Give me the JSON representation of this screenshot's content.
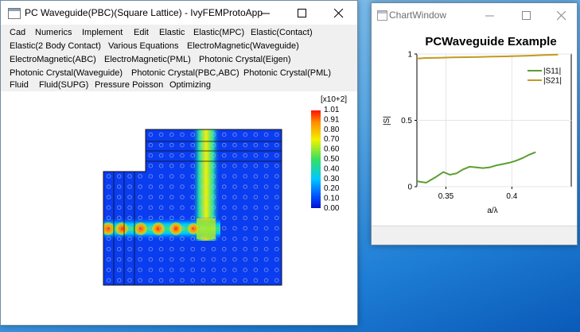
{
  "main_window": {
    "title": "PC Waveguide(PBC)(Square Lattice) - IvyFEMProtoApp",
    "menu_rows": [
      [
        "Cad",
        "Numerics",
        "Implement",
        "Edit",
        "Elastic",
        "Elastic(MPC)",
        "Elastic(Contact)"
      ],
      [
        "Elastic(2 Body Contact)",
        "Various Equations",
        "ElectroMagnetic(Waveguide)"
      ],
      [
        "ElectroMagnetic(ABC)",
        "ElectroMagnetic(PML)",
        "Photonic Crystal(Eigen)"
      ],
      [
        "Photonic Crystal(Waveguide)",
        "Photonic Crystal(PBC,ABC)",
        "Photonic Crystal(PML)"
      ],
      [
        "Fluid",
        "Fluid(SUPG)",
        "Pressure Poisson",
        "Optimizing"
      ]
    ],
    "colorbar": {
      "scale_label": "[x10+2]",
      "ticks": [
        "1.01",
        "0.91",
        "0.80",
        "0.70",
        "0.60",
        "0.50",
        "0.40",
        "0.30",
        "0.20",
        "0.10",
        "0.00"
      ]
    }
  },
  "chart_window": {
    "title": "ChartWindow"
  },
  "chart_data": {
    "type": "line",
    "title": "PCWaveguide Example",
    "xlabel": "a/λ",
    "ylabel": "|S|",
    "xlim": [
      0.328,
      0.445
    ],
    "ylim": [
      0,
      1
    ],
    "x_ticks": [
      "0.35",
      "0.4"
    ],
    "y_ticks": [
      "0",
      "0.5",
      "1"
    ],
    "legend_position": "top-right",
    "series": [
      {
        "name": "|S11|",
        "color": "#5a9e2e",
        "x": [
          0.328,
          0.335,
          0.342,
          0.348,
          0.353,
          0.358,
          0.363,
          0.368,
          0.373,
          0.378,
          0.383,
          0.388,
          0.393,
          0.398,
          0.403,
          0.408,
          0.413,
          0.418
        ],
        "y": [
          0.04,
          0.03,
          0.07,
          0.11,
          0.09,
          0.1,
          0.13,
          0.15,
          0.145,
          0.14,
          0.145,
          0.16,
          0.17,
          0.18,
          0.195,
          0.215,
          0.24,
          0.26
        ]
      },
      {
        "name": "|S21|",
        "color": "#c49a1e",
        "x": [
          0.328,
          0.335,
          0.345,
          0.355,
          0.365,
          0.375,
          0.385,
          0.395,
          0.405,
          0.415,
          0.425,
          0.435
        ],
        "y": [
          0.965,
          0.97,
          0.972,
          0.974,
          0.976,
          0.978,
          0.98,
          0.982,
          0.985,
          0.988,
          0.992,
          0.995
        ]
      }
    ]
  }
}
